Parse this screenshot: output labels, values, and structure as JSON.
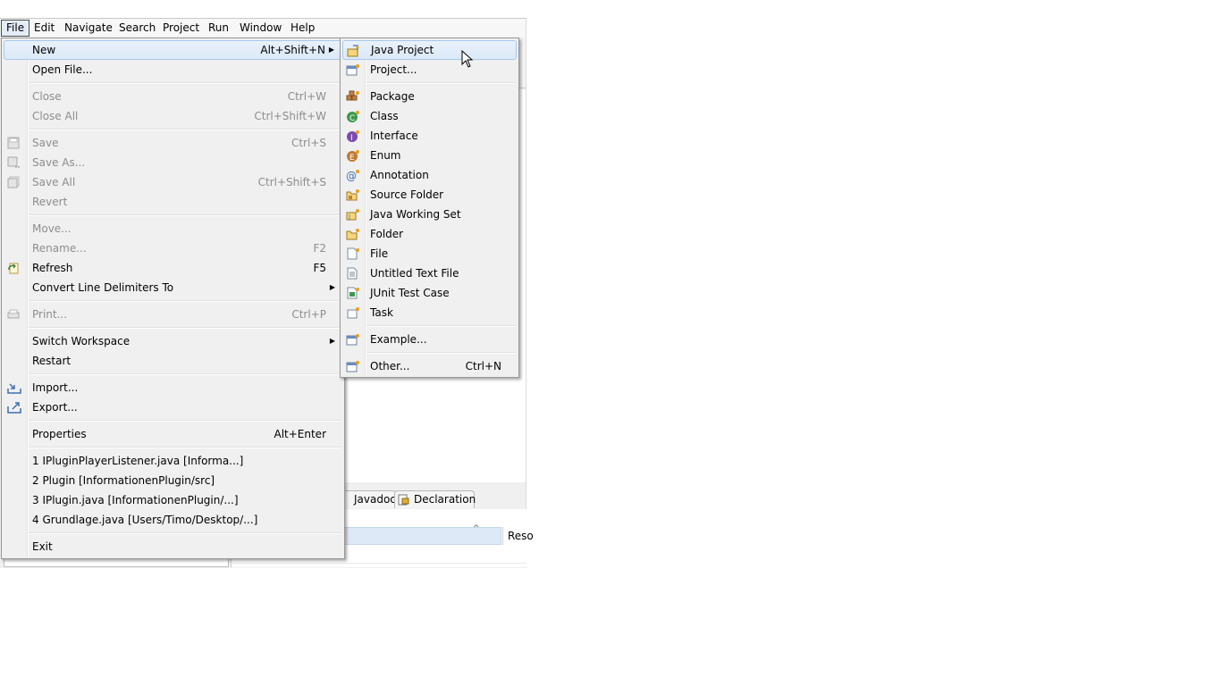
{
  "menubar": {
    "items": [
      "File",
      "Edit",
      "Navigate",
      "Search",
      "Project",
      "Run",
      "Window",
      "Help"
    ]
  },
  "file_menu": {
    "new": {
      "label": "New",
      "shortcut": "Alt+Shift+N"
    },
    "open_file": {
      "label": "Open File..."
    },
    "close": {
      "label": "Close",
      "shortcut": "Ctrl+W"
    },
    "close_all": {
      "label": "Close All",
      "shortcut": "Ctrl+Shift+W"
    },
    "save": {
      "label": "Save",
      "shortcut": "Ctrl+S"
    },
    "save_as": {
      "label": "Save As..."
    },
    "save_all": {
      "label": "Save All",
      "shortcut": "Ctrl+Shift+S"
    },
    "revert": {
      "label": "Revert"
    },
    "move": {
      "label": "Move..."
    },
    "rename": {
      "label": "Rename...",
      "shortcut": "F2"
    },
    "refresh": {
      "label": "Refresh",
      "shortcut": "F5"
    },
    "convert": {
      "label": "Convert Line Delimiters To"
    },
    "print": {
      "label": "Print...",
      "shortcut": "Ctrl+P"
    },
    "switch_workspace": {
      "label": "Switch Workspace"
    },
    "restart": {
      "label": "Restart"
    },
    "import": {
      "label": "Import..."
    },
    "export": {
      "label": "Export..."
    },
    "properties": {
      "label": "Properties",
      "shortcut": "Alt+Enter"
    },
    "recent": [
      "1 IPluginPlayerListener.java  [Informa...]",
      "2 Plugin  [InformationenPlugin/src]",
      "3 IPlugin.java  [InformationenPlugin/...]",
      "4 Grundlage.java  [Users/Timo/Desktop/...]"
    ],
    "exit": {
      "label": "Exit"
    }
  },
  "new_menu": {
    "items": [
      {
        "label": "Java Project"
      },
      {
        "label": "Project..."
      },
      {
        "label": "Package"
      },
      {
        "label": "Class"
      },
      {
        "label": "Interface"
      },
      {
        "label": "Enum"
      },
      {
        "label": "Annotation"
      },
      {
        "label": "Source Folder"
      },
      {
        "label": "Java Working Set"
      },
      {
        "label": "Folder"
      },
      {
        "label": "File"
      },
      {
        "label": "Untitled Text File"
      },
      {
        "label": "JUnit Test Case"
      },
      {
        "label": "Task"
      },
      {
        "label": "Example..."
      },
      {
        "label": "Other...",
        "shortcut": "Ctrl+N"
      }
    ]
  },
  "bottom_tabs": {
    "javadoc": "Javadoc",
    "declaration": "Declaration"
  },
  "table": {
    "col2_header": "Reso"
  },
  "colors": {
    "menu_bg": "#f0f0f0",
    "highlight_bg": "#dbe9f8",
    "highlight_border": "#a8c8ec",
    "disabled_text": "#8d8d8d"
  }
}
